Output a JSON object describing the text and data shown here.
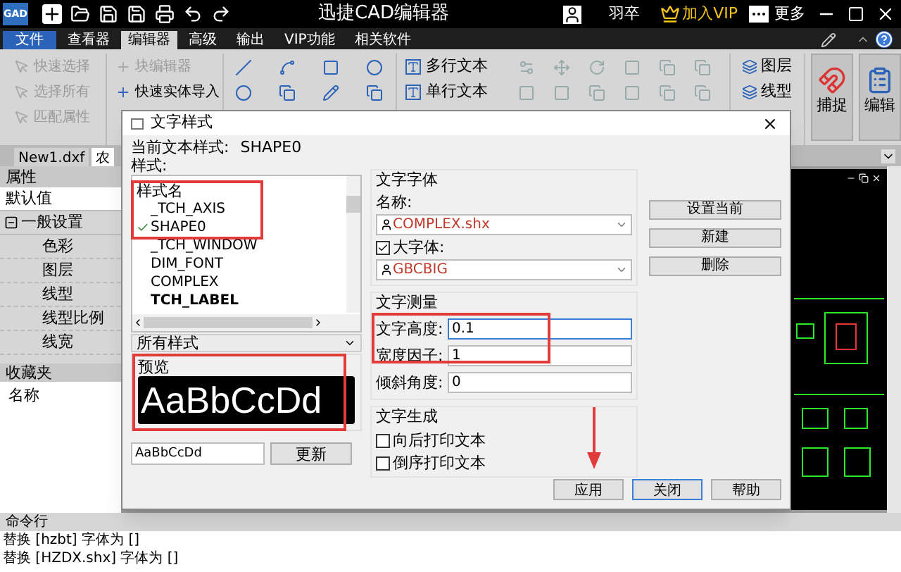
{
  "window": {
    "logo": "GAD",
    "title": "迅捷CAD编辑器",
    "user": "羽卒",
    "vip": "加入VIP",
    "more": "更多"
  },
  "file_menu": "文件",
  "menu": [
    {
      "label": "查看器",
      "kind": "tab",
      "selected": false
    },
    {
      "label": "编辑器",
      "kind": "tab",
      "selected": true
    },
    {
      "label": "高级",
      "kind": "tab",
      "selected": false
    },
    {
      "label": "输出",
      "kind": "tab",
      "selected": false
    },
    {
      "label": "VIP功能",
      "kind": "tab",
      "selected": false
    },
    {
      "label": "相关软件",
      "kind": "tab",
      "selected": false
    }
  ],
  "ribbon": {
    "select_group": [
      {
        "label": "快速选择",
        "disabled": true
      },
      {
        "label": "选择所有",
        "disabled": true
      },
      {
        "label": "匹配属性",
        "disabled": true
      }
    ],
    "block_group": [
      {
        "label": "块编辑器",
        "disabled": true
      },
      {
        "label": "快速实体导入",
        "disabled": false
      }
    ],
    "text_group": [
      {
        "label": "多行文本"
      },
      {
        "label": "单行文本"
      }
    ],
    "layer_group": [
      {
        "label": "图层"
      },
      {
        "label": "线型"
      }
    ],
    "big_buttons": [
      {
        "label": "捕捉"
      },
      {
        "label": "编辑"
      }
    ]
  },
  "doc_tabs": [
    {
      "label": "New1.dxf",
      "selected": false
    },
    {
      "label": "农",
      "selected": true
    }
  ],
  "properties": {
    "title": "属性",
    "default_row": "默认值",
    "sections": [
      {
        "label": "一般设置",
        "expanded": true,
        "children": [
          {
            "label": "色彩"
          },
          {
            "label": "图层"
          },
          {
            "label": "线型"
          },
          {
            "label": "线型比例"
          },
          {
            "label": "线宽"
          }
        ]
      }
    ]
  },
  "favorites": {
    "title": "收藏夹",
    "column": "名称"
  },
  "command_line": {
    "title": "命令行",
    "lines": [
      "替换 [hzbt] 字体为 []",
      "替换 [HZDX.shx] 字体为 []"
    ]
  },
  "dialog": {
    "title": "文字样式",
    "current_label": "当前文本样式:",
    "current_value": "SHAPE0",
    "styles_label": "样式:",
    "style_list": {
      "header": "样式名",
      "items": [
        {
          "label": "_TCH_AXIS",
          "checked": false,
          "bold": false
        },
        {
          "label": "SHAPE0",
          "checked": true,
          "bold": false
        },
        {
          "label": "_TCH_WINDOW",
          "checked": false,
          "bold": false
        },
        {
          "label": "DIM_FONT",
          "checked": false,
          "bold": false
        },
        {
          "label": "COMPLEX",
          "checked": false,
          "bold": false
        },
        {
          "label": "TCH_LABEL",
          "checked": false,
          "bold": true
        }
      ]
    },
    "filter": "所有样式",
    "preview_label": "预览",
    "preview_text": "AaBbCcDd",
    "preview_input": "AaBbCcDd",
    "update_button": "更新",
    "font": {
      "title": "文字字体",
      "name_label": "名称:",
      "name_value": "COMPLEX.shx",
      "big_font_label": "大字体:",
      "big_font_checked": true,
      "big_font_value": "GBCBIG"
    },
    "measure": {
      "title": "文字测量",
      "fields": [
        {
          "label": "文字高度:",
          "value": "0.1",
          "focused": true
        },
        {
          "label": "宽度因子:",
          "value": "1",
          "focused": false
        },
        {
          "label": "倾斜角度:",
          "value": "0",
          "focused": false
        }
      ]
    },
    "generation": {
      "title": "文字生成",
      "options": [
        {
          "label": "向后打印文本",
          "checked": false
        },
        {
          "label": "倒序打印文本",
          "checked": false
        }
      ]
    },
    "side_buttons": [
      "设置当前",
      "新建",
      "删除"
    ],
    "buttons": [
      {
        "label": "应用",
        "focused": false
      },
      {
        "label": "关闭",
        "focused": true
      },
      {
        "label": "帮助",
        "focused": false
      }
    ]
  }
}
